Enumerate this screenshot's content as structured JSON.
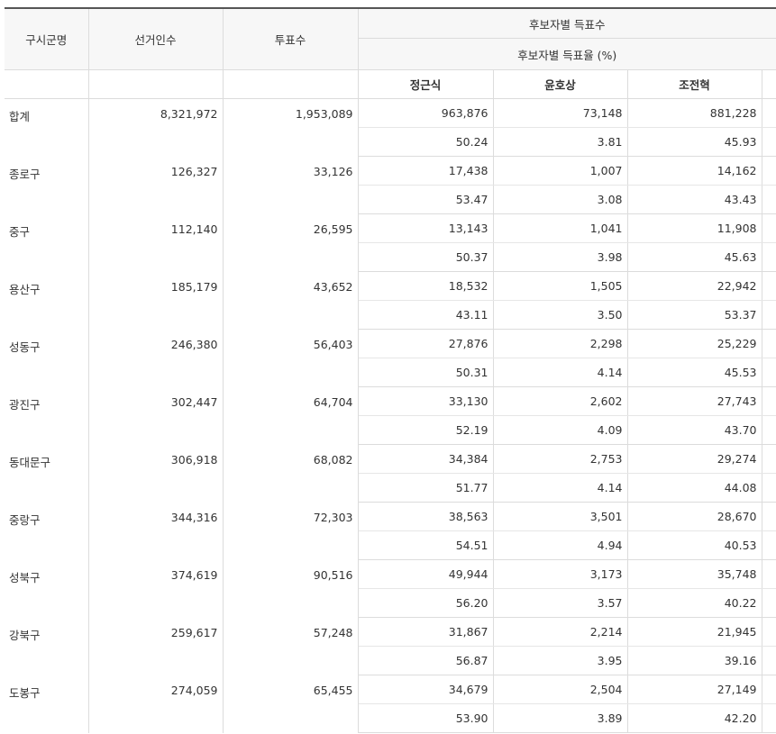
{
  "headers": {
    "district": "구시군명",
    "electorate": "선거인수",
    "votes": "투표수",
    "group_title": "후보자별 득표수",
    "group_subtitle": "후보자별 득표율 (%)",
    "candidates": [
      "정근식",
      "윤호상",
      "조전혁"
    ]
  },
  "rows": [
    {
      "name": "합계",
      "electorate": "8,321,972",
      "votes": "1,953,089",
      "counts": [
        "963,876",
        "73,148",
        "881,228"
      ],
      "rates": [
        "50.24",
        "3.81",
        "45.93"
      ]
    },
    {
      "name": "종로구",
      "electorate": "126,327",
      "votes": "33,126",
      "counts": [
        "17,438",
        "1,007",
        "14,162"
      ],
      "rates": [
        "53.47",
        "3.08",
        "43.43"
      ]
    },
    {
      "name": "중구",
      "electorate": "112,140",
      "votes": "26,595",
      "counts": [
        "13,143",
        "1,041",
        "11,908"
      ],
      "rates": [
        "50.37",
        "3.98",
        "45.63"
      ]
    },
    {
      "name": "용산구",
      "electorate": "185,179",
      "votes": "43,652",
      "counts": [
        "18,532",
        "1,505",
        "22,942"
      ],
      "rates": [
        "43.11",
        "3.50",
        "53.37"
      ]
    },
    {
      "name": "성동구",
      "electorate": "246,380",
      "votes": "56,403",
      "counts": [
        "27,876",
        "2,298",
        "25,229"
      ],
      "rates": [
        "50.31",
        "4.14",
        "45.53"
      ]
    },
    {
      "name": "광진구",
      "electorate": "302,447",
      "votes": "64,704",
      "counts": [
        "33,130",
        "2,602",
        "27,743"
      ],
      "rates": [
        "52.19",
        "4.09",
        "43.70"
      ]
    },
    {
      "name": "동대문구",
      "electorate": "306,918",
      "votes": "68,082",
      "counts": [
        "34,384",
        "2,753",
        "29,274"
      ],
      "rates": [
        "51.77",
        "4.14",
        "44.08"
      ]
    },
    {
      "name": "중랑구",
      "electorate": "344,316",
      "votes": "72,303",
      "counts": [
        "38,563",
        "3,501",
        "28,670"
      ],
      "rates": [
        "54.51",
        "4.94",
        "40.53"
      ]
    },
    {
      "name": "성북구",
      "electorate": "374,619",
      "votes": "90,516",
      "counts": [
        "49,944",
        "3,173",
        "35,748"
      ],
      "rates": [
        "56.20",
        "3.57",
        "40.22"
      ]
    },
    {
      "name": "강북구",
      "electorate": "259,617",
      "votes": "57,248",
      "counts": [
        "31,867",
        "2,214",
        "21,945"
      ],
      "rates": [
        "56.87",
        "3.95",
        "39.16"
      ]
    },
    {
      "name": "도봉구",
      "electorate": "274,059",
      "votes": "65,455",
      "counts": [
        "34,679",
        "2,504",
        "27,149"
      ],
      "rates": [
        "53.90",
        "3.89",
        "42.20"
      ]
    }
  ]
}
